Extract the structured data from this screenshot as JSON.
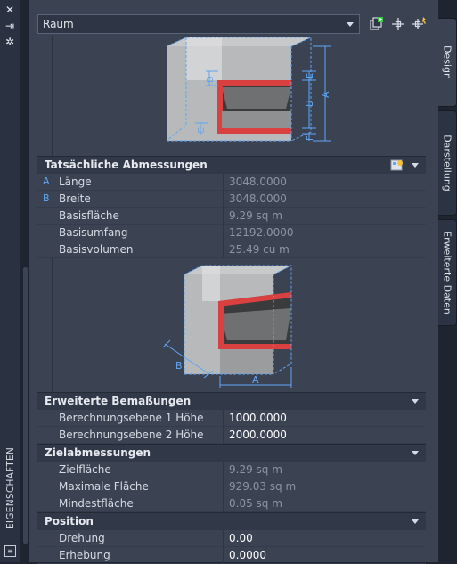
{
  "window": {
    "title_vertical": "EIGENSCHAFTEN",
    "close_glyph": "✕",
    "autohide_glyph": "⇥",
    "settings_glyph": "✲"
  },
  "header": {
    "object_type": "Raum"
  },
  "tabs": [
    {
      "label": "Design"
    },
    {
      "label": "Darstellung"
    },
    {
      "label": "Erweiterte Daten"
    }
  ],
  "diagram_top": {
    "labels": {
      "a": "A",
      "b": "B",
      "c": "C",
      "d": "D",
      "e": "E",
      "f": "F"
    }
  },
  "sections": {
    "actual": {
      "title": "Tatsächliche Abmessungen",
      "rows": [
        {
          "key": "A",
          "label": "Länge",
          "value": "3048.0000"
        },
        {
          "key": "B",
          "label": "Breite",
          "value": "3048.0000"
        },
        {
          "key": "",
          "label": "Basisfläche",
          "value": "9.29 sq m"
        },
        {
          "key": "",
          "label": "Basisumfang",
          "value": "12192.0000"
        },
        {
          "key": "",
          "label": "Basisvolumen",
          "value": "25.49  cu m"
        }
      ]
    },
    "extended": {
      "title": "Erweiterte Bemaßungen",
      "rows": [
        {
          "label": "Berechnungsebene 1 Höhe",
          "value": "1000.0000"
        },
        {
          "label": "Berechnungsebene 2 Höhe",
          "value": "2000.0000"
        }
      ]
    },
    "target": {
      "title": "Zielabmessungen",
      "rows": [
        {
          "label": "Zielfläche",
          "value": "9.29 sq m"
        },
        {
          "label": "Maximale Fläche",
          "value": "929.03 sq m"
        },
        {
          "label": "Mindestfläche",
          "value": "0.05 sq m"
        }
      ]
    },
    "position": {
      "title": "Position",
      "rows": [
        {
          "label": "Drehung",
          "value": "0.00"
        },
        {
          "label": "Erhebung",
          "value": "0.0000"
        }
      ]
    }
  },
  "diagram_bottom": {
    "labels": {
      "a": "A",
      "b": "B"
    }
  },
  "colors": {
    "accent_red": "#d94040",
    "accent_blue": "#5fa6f4",
    "panel_bg": "#3b4353",
    "header_bg": "#313848"
  }
}
